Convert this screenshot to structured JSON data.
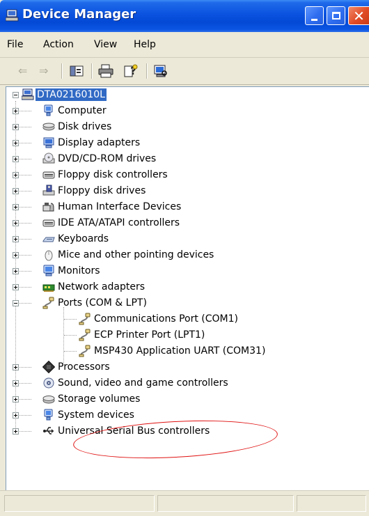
{
  "window": {
    "title": "Device Manager"
  },
  "menu": {
    "items": [
      "File",
      "Action",
      "View",
      "Help"
    ]
  },
  "toolbar": {
    "buttons": [
      {
        "icon": "back-arrow-icon",
        "enabled": false
      },
      {
        "icon": "forward-arrow-icon",
        "enabled": false
      },
      {
        "icon": "show-hide-tree-icon",
        "enabled": true
      },
      {
        "icon": "print-icon",
        "enabled": true
      },
      {
        "icon": "help-icon",
        "enabled": true
      },
      {
        "icon": "scan-hardware-icon",
        "enabled": true
      }
    ]
  },
  "tree": {
    "root": {
      "label": "DTA0216010L",
      "icon": "computer-icon",
      "expanded": true,
      "selected": true
    },
    "items": [
      {
        "label": "Computer",
        "icon": "computer-icon",
        "expanded": false
      },
      {
        "label": "Disk drives",
        "icon": "disk-drive-icon",
        "expanded": false
      },
      {
        "label": "Display adapters",
        "icon": "display-adapter-icon",
        "expanded": false
      },
      {
        "label": "DVD/CD-ROM drives",
        "icon": "cd-drive-icon",
        "expanded": false
      },
      {
        "label": "Floppy disk controllers",
        "icon": "controller-icon",
        "expanded": false
      },
      {
        "label": "Floppy disk drives",
        "icon": "floppy-drive-icon",
        "expanded": false
      },
      {
        "label": "Human Interface Devices",
        "icon": "hid-icon",
        "expanded": false
      },
      {
        "label": "IDE ATA/ATAPI controllers",
        "icon": "controller-icon",
        "expanded": false
      },
      {
        "label": "Keyboards",
        "icon": "keyboard-icon",
        "expanded": false
      },
      {
        "label": "Mice and other pointing devices",
        "icon": "mouse-icon",
        "expanded": false
      },
      {
        "label": "Monitors",
        "icon": "monitor-icon",
        "expanded": false
      },
      {
        "label": "Network adapters",
        "icon": "network-icon",
        "expanded": false
      },
      {
        "label": "Ports (COM & LPT)",
        "icon": "port-icon",
        "expanded": true,
        "children": [
          {
            "label": "Communications Port (COM1)",
            "icon": "port-icon"
          },
          {
            "label": "ECP Printer Port (LPT1)",
            "icon": "port-icon"
          },
          {
            "label": "MSP430 Application UART (COM31)",
            "icon": "port-icon",
            "highlighted": true
          }
        ]
      },
      {
        "label": "Processors",
        "icon": "processor-icon",
        "expanded": false
      },
      {
        "label": "Sound, video and game controllers",
        "icon": "sound-icon",
        "expanded": false
      },
      {
        "label": "Storage volumes",
        "icon": "storage-icon",
        "expanded": false
      },
      {
        "label": "System devices",
        "icon": "system-icon",
        "expanded": false
      },
      {
        "label": "Universal Serial Bus controllers",
        "icon": "usb-icon",
        "expanded": false
      }
    ]
  },
  "colors": {
    "titlebar": "#0a52df",
    "selection": "#316ac5",
    "annotation": "#e01010"
  }
}
